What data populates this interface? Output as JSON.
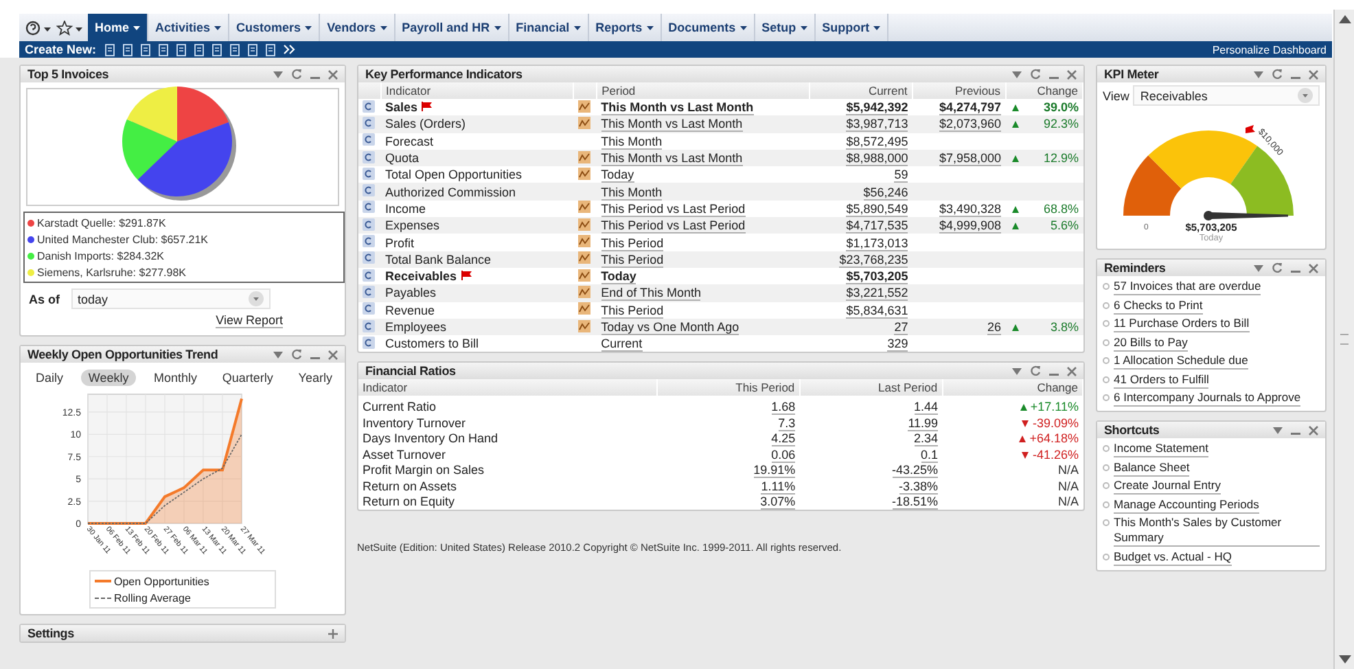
{
  "nav": {
    "tabs": [
      {
        "label": "Home",
        "selected": true
      },
      {
        "label": "Activities",
        "selected": false
      },
      {
        "label": "Customers",
        "selected": false
      },
      {
        "label": "Vendors",
        "selected": false
      },
      {
        "label": "Payroll and HR",
        "selected": false
      },
      {
        "label": "Financial",
        "selected": false
      },
      {
        "label": "Reports",
        "selected": false
      },
      {
        "label": "Documents",
        "selected": false
      },
      {
        "label": "Setup",
        "selected": false
      },
      {
        "label": "Support",
        "selected": false
      }
    ],
    "create_label": "Create New:",
    "personalize": "Personalize Dashboard"
  },
  "top_invoices": {
    "title": "Top 5 Invoices",
    "chart_data": {
      "type": "pie",
      "categories": [
        "Karstadt Quelle: $291.87K",
        "United Manchester Club: $657.21K",
        "Danish Imports: $284.32K",
        "Siemens, Karlsruhe: $277.98K"
      ],
      "values": [
        291.87,
        657.21,
        284.32,
        277.98
      ],
      "colors": [
        "#ee4444",
        "#4444ee",
        "#44ee44",
        "#eeee44"
      ]
    },
    "as_of_label": "As of",
    "as_of_value": "today",
    "view_report": "View Report"
  },
  "trend": {
    "title": "Weekly Open Opportunities Trend",
    "periods": [
      {
        "label": "Daily",
        "selected": false
      },
      {
        "label": "Weekly",
        "selected": true
      },
      {
        "label": "Monthly",
        "selected": false
      },
      {
        "label": "Quarterly",
        "selected": false
      },
      {
        "label": "Yearly",
        "selected": false
      }
    ],
    "chart_data": {
      "type": "line",
      "grid": true,
      "categories": [
        "30 Jan 11",
        "06 Feb 11",
        "13 Feb 11",
        "20 Feb 11",
        "27 Feb 11",
        "06 Mar 11",
        "13 Mar 11",
        "20 Mar 11",
        "27 Mar 11"
      ],
      "ylim": [
        0,
        14.5
      ],
      "yticks": [
        0,
        2.5,
        5,
        7.5,
        10,
        12.5
      ],
      "series": [
        {
          "name": "Open Opportunities",
          "color": "#f47a2a",
          "line_style": "solid",
          "values": [
            0,
            0,
            0,
            0,
            3,
            4,
            6,
            6,
            14
          ]
        },
        {
          "name": "Rolling Average",
          "color": "#666666",
          "line_style": "dashed",
          "values": [
            0,
            0,
            0,
            0,
            2,
            3.5,
            5,
            6.2,
            10
          ]
        }
      ]
    }
  },
  "settings": {
    "title": "Settings"
  },
  "kpi": {
    "title": "Key Performance Indicators",
    "columns": [
      "Indicator",
      "Period",
      "Current",
      "Previous",
      "Change"
    ],
    "rows": [
      {
        "indicator": "Sales",
        "highlighted": true,
        "chart": true,
        "period": "This Month vs Last Month",
        "current": "$5,942,392",
        "previous": "$4,274,797",
        "rising": true,
        "change": "39.0%"
      },
      {
        "indicator": "Sales (Orders)",
        "highlighted": false,
        "chart": true,
        "period": "This Month vs Last Month",
        "current": "$3,987,713",
        "previous": "$2,073,960",
        "rising": true,
        "change": "92.3%"
      },
      {
        "indicator": "Forecast",
        "highlighted": false,
        "chart": false,
        "period": "This Month",
        "current": "$8,572,495"
      },
      {
        "indicator": "Quota",
        "highlighted": false,
        "chart": true,
        "period": "This Month vs Last Month",
        "current": "$8,988,000",
        "previous": "$7,958,000",
        "rising": true,
        "change": "12.9%"
      },
      {
        "indicator": "Total Open Opportunities",
        "highlighted": false,
        "chart": true,
        "period": "Today",
        "current": "59"
      },
      {
        "indicator": "Authorized Commission",
        "highlighted": false,
        "chart": false,
        "period": "This Month",
        "current": "$56,246"
      },
      {
        "indicator": "Income",
        "highlighted": false,
        "chart": true,
        "period": "This Period vs Last Period",
        "current": "$5,890,549",
        "previous": "$3,490,328",
        "rising": true,
        "change": "68.8%"
      },
      {
        "indicator": "Expenses",
        "highlighted": false,
        "chart": true,
        "period": "This Period vs Last Period",
        "current": "$4,717,535",
        "previous": "$4,999,908",
        "rising": true,
        "change": "5.6%"
      },
      {
        "indicator": "Profit",
        "highlighted": false,
        "chart": true,
        "period": "This Period",
        "current": "$1,173,013"
      },
      {
        "indicator": "Total Bank Balance",
        "highlighted": false,
        "chart": true,
        "period": "This Period",
        "current": "$23,768,235"
      },
      {
        "indicator": "Receivables",
        "highlighted": true,
        "chart": true,
        "period": "Today",
        "current": "$5,703,205"
      },
      {
        "indicator": "Payables",
        "highlighted": false,
        "chart": true,
        "period": "End of This Month",
        "current": "$3,221,552"
      },
      {
        "indicator": "Revenue",
        "highlighted": false,
        "chart": true,
        "period": "This Period",
        "current": "$5,834,631"
      },
      {
        "indicator": "Employees",
        "highlighted": false,
        "chart": true,
        "period": "Today vs One Month Ago",
        "current": "27",
        "previous": "26",
        "rising": true,
        "change": "3.8%"
      },
      {
        "indicator": "Customers to Bill",
        "highlighted": false,
        "chart": false,
        "period": "Current",
        "current": "329"
      }
    ]
  },
  "ratios": {
    "title": "Financial Ratios",
    "columns": [
      "Indicator",
      "This Period",
      "Last Period",
      "Change"
    ],
    "rows": [
      {
        "indicator": "Current Ratio",
        "this_period": "1.68",
        "last_period": "1.44",
        "rising": true,
        "favorable": true,
        "change": "+17.11%"
      },
      {
        "indicator": "Inventory Turnover",
        "this_period": "7.3",
        "last_period": "11.99",
        "rising": false,
        "favorable": false,
        "change": "-39.09%"
      },
      {
        "indicator": "Days Inventory On Hand",
        "this_period": "4.25",
        "last_period": "2.34",
        "rising": true,
        "favorable": false,
        "change": "+64.18%"
      },
      {
        "indicator": "Asset Turnover",
        "this_period": "0.06",
        "last_period": "0.1",
        "rising": false,
        "favorable": false,
        "change": "-41.26%"
      },
      {
        "indicator": "Profit Margin on Sales",
        "this_period": "19.91%",
        "last_period": "-43.25%",
        "change": "N/A"
      },
      {
        "indicator": "Return on Assets",
        "this_period": "1.11%",
        "last_period": "-3.38%",
        "change": "N/A"
      },
      {
        "indicator": "Return on Equity",
        "this_period": "3.07%",
        "last_period": "-18.51%",
        "change": "N/A"
      }
    ]
  },
  "footer": "NetSuite (Edition: United States) Release 2010.2 Copyright © NetSuite Inc. 1999-2011. All rights reserved.",
  "kpi_meter": {
    "title": "KPI Meter",
    "view_label": "View",
    "view_value": "Receivables",
    "min_label": "0",
    "max_label": "$10,000",
    "level": 1,
    "value": "$5,703,205",
    "caption": "Today"
  },
  "reminders": {
    "title": "Reminders",
    "items": [
      "57 Invoices that are overdue",
      "6 Checks to Print",
      "11 Purchase Orders to Bill",
      "20 Bills to Pay",
      "1 Allocation Schedule due",
      "41 Orders to Fulfill",
      "6 Intercompany Journals to Approve"
    ]
  },
  "shortcuts": {
    "title": "Shortcuts",
    "items": [
      "Income Statement",
      "Balance Sheet",
      "Create Journal Entry",
      "Manage Accounting Periods",
      "This Month's Sales by Customer Summary",
      "Budget vs. Actual - HQ"
    ]
  }
}
